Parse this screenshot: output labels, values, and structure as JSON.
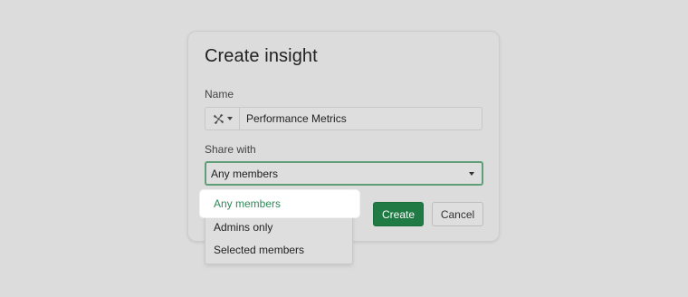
{
  "dialog": {
    "title": "Create insight",
    "name_label": "Name",
    "name_value": "Performance Metrics",
    "icon": "pinwheel-icon",
    "share_label": "Share with",
    "share_value": "Any members",
    "create_label": "Create",
    "cancel_label": "Cancel"
  },
  "share_options": [
    {
      "label": "Any members",
      "selected": true
    },
    {
      "label": "Admins only",
      "selected": false
    },
    {
      "label": "Selected members",
      "selected": false
    }
  ],
  "colors": {
    "accent": "#1f7a44",
    "selected_text": "#2d8a57",
    "focus_border": "#5f9e78"
  }
}
